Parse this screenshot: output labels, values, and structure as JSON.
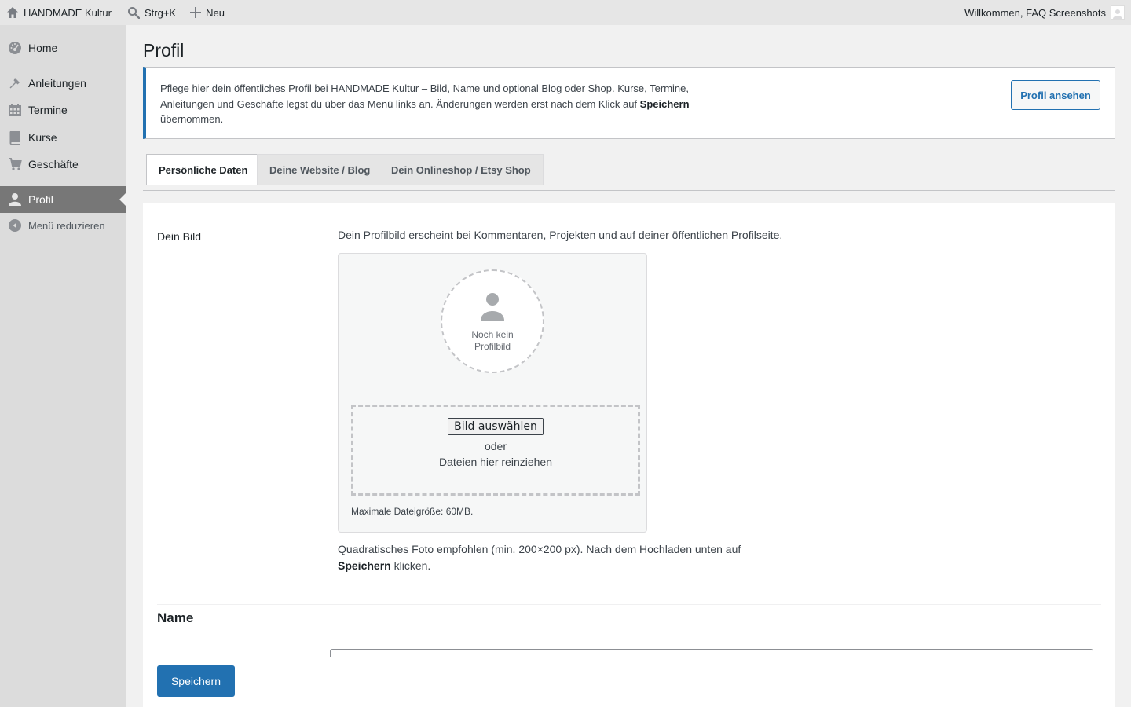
{
  "adminbar": {
    "site_name": "HANDMADE Kultur",
    "search_shortcut": "Strg+K",
    "new_label": "Neu",
    "greeting": "Willkommen, FAQ Screenshots"
  },
  "sidebar": {
    "items": [
      {
        "label": "Home",
        "icon": "dashboard-icon"
      },
      {
        "label": "Anleitungen",
        "icon": "hammer-icon"
      },
      {
        "label": "Termine",
        "icon": "calendar-icon"
      },
      {
        "label": "Kurse",
        "icon": "book-icon"
      },
      {
        "label": "Geschäfte",
        "icon": "cart-icon"
      },
      {
        "label": "Profil",
        "icon": "user-icon",
        "active": true
      }
    ],
    "collapse_label": "Menü reduzieren"
  },
  "page": {
    "title": "Profil"
  },
  "notice": {
    "text_1": "Pflege hier dein öffentliches Profil bei HANDMADE Kultur – Bild, Name und optional Blog oder Shop. Kurse, Termine, Anleitungen und Geschäfte legst du über das Menü links an. Änderungen werden erst nach dem Klick auf ",
    "text_bold": "Speichern",
    "text_2": " übernommen.",
    "button": "Profil ansehen"
  },
  "tabs": [
    {
      "label": "Persönliche Daten",
      "active": true
    },
    {
      "label": "Deine Website / Blog",
      "active": false
    },
    {
      "label": "Dein Onlineshop / Etsy Shop",
      "active": false
    }
  ],
  "picture": {
    "label": "Dein Bild",
    "description": "Dein Profilbild erscheint bei Kommentaren, Projekten und auf deiner öffentlichen Profilseite.",
    "placeholder_text": "Noch kein Profilbild",
    "choose_button": "Bild auswählen",
    "or_text": "oder",
    "drop_text": "Dateien hier reinziehen",
    "max_size": "Maximale Dateigröße: 60MB.",
    "hint_1": "Quadratisches Foto empfohlen (min. 200×200 px). Nach dem Hochladen unten auf ",
    "hint_bold": "Speichern",
    "hint_2": " klicken."
  },
  "name_section": {
    "title": "Name"
  },
  "footer": {
    "save_button": "Speichern"
  },
  "colors": {
    "primary": "#2271b1",
    "sidebar_active": "#777777",
    "adminbar_bg": "#e6e6e6"
  }
}
